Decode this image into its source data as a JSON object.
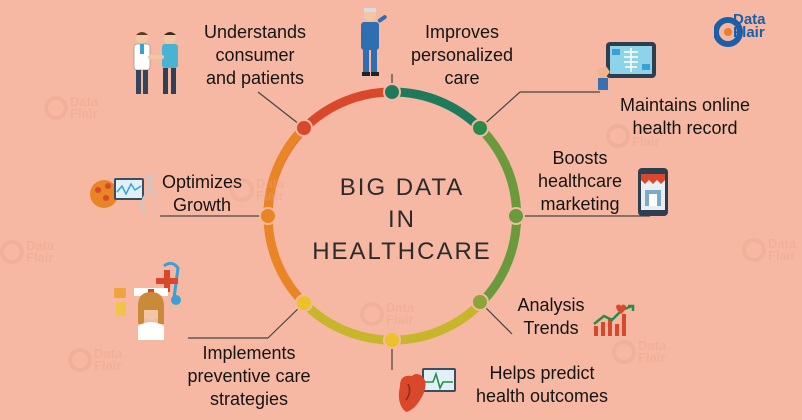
{
  "center_title": "BIG DATA\nIN\nHEALTHCARE",
  "brand": {
    "text": "Data\nFlair",
    "color": "#1b5fa8"
  },
  "watermark": {
    "text": "Data\nFlair"
  },
  "colors": {
    "background": "#f6b8a2",
    "ring_red": "#d9482a",
    "ring_orange": "#e98524",
    "ring_yellow": "#ecc12a",
    "ring_olive": "#8ca537",
    "ring_green": "#2b8a4a",
    "ring_teal": "#1f7a5c"
  },
  "items": [
    {
      "label": "Understands\nconsumer\nand patients",
      "icon": "handshake-doctor-icon"
    },
    {
      "label": "Improves\npersonalized\ncare",
      "icon": "doctor-pointing-icon"
    },
    {
      "label": "Maintains online\nhealth record",
      "icon": "tablet-xray-icon"
    },
    {
      "label": "Boosts\nhealthcare\nmarketing",
      "icon": "mobile-shop-icon"
    },
    {
      "label": "Analysis\nTrends",
      "icon": "trend-chart-icon"
    },
    {
      "label": "Helps predict\nhealth outcomes",
      "icon": "heart-monitor-icon"
    },
    {
      "label": "Implements\npreventive care\nstrategies",
      "icon": "nurse-stethoscope-icon"
    },
    {
      "label": "Optimizes\nGrowth",
      "icon": "brain-dna-icon"
    }
  ]
}
